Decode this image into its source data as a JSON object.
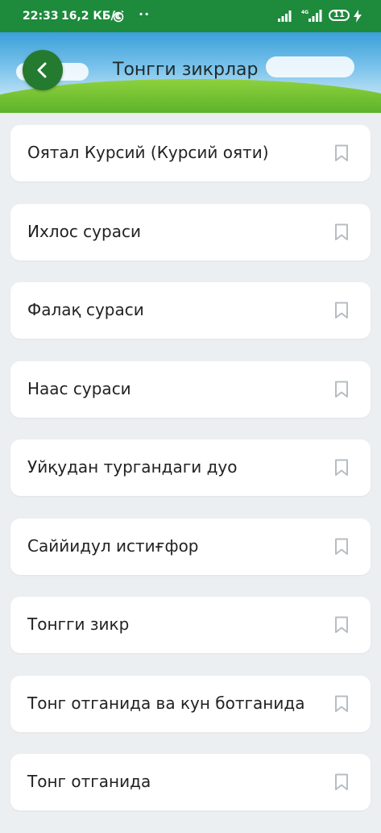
{
  "status_bar": {
    "time": "22:33",
    "speed": "16,2 КБ/с",
    "battery": "11",
    "network": "4G"
  },
  "header": {
    "title": "Тонгги зикрлар",
    "back_icon": "chevron-left-icon"
  },
  "items": [
    {
      "label": "Оятал Курсий (Курсий ояти)"
    },
    {
      "label": "Ихлос сураси"
    },
    {
      "label": "Фалақ сураси"
    },
    {
      "label": "Наас сураси"
    },
    {
      "label": "Уйқудан тургандаги дуо"
    },
    {
      "label": "Саййидул истиғфор"
    },
    {
      "label": "Тонгги зикр"
    },
    {
      "label": "Тонг отганида ва кун ботганида"
    },
    {
      "label": "Тонг отганида"
    }
  ],
  "colors": {
    "status_bar": "#1d8a3c",
    "back_button": "#247a2f",
    "background": "#eceff1",
    "card": "#ffffff",
    "bookmark": "#b8bdc2"
  }
}
